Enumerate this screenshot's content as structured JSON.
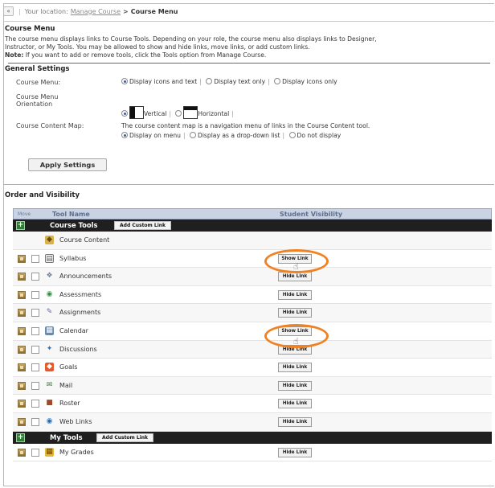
{
  "breadcrumb": {
    "back": "«",
    "prefix": "Your location:",
    "link": "Manage Course",
    "arrow": ">",
    "current": "Course Menu"
  },
  "course_menu": {
    "title": "Course Menu",
    "desc1": "The course menu displays links to Course Tools. Depending on your role, the course menu also displays links to Designer,",
    "desc2": "Instructor, or My Tools. You may be allowed to show and hide links, move links, or add custom links.",
    "note_label": "Note:",
    "note_text": " If you want to add or remove tools, click the Tools option from Manage Course."
  },
  "general": {
    "title": "General Settings",
    "menu_label": "Course Menu:",
    "menu_opts": [
      "Display icons and text",
      "Display text only",
      "Display icons only"
    ],
    "orient_label1": "Course Menu",
    "orient_label2": "Orientation",
    "orient_opts": [
      "Vertical",
      "Horizontal"
    ],
    "map_label": "Course Content Map:",
    "map_desc": "The course content map is a navigation menu of links in the Course Content tool.",
    "map_opts": [
      "Display on menu",
      "Display as a drop-down list",
      "Do not display"
    ],
    "apply": "Apply Settings"
  },
  "order": {
    "title": "Order and Visibility",
    "col_move": "Move",
    "col_name": "Tool Name",
    "col_vis": "Student Visibility",
    "groups": [
      {
        "name": "Course Tools",
        "add": "Add Custom Link",
        "tools": [
          {
            "name": "Course Content",
            "button": "",
            "icon": "content-icon"
          },
          {
            "name": "Syllabus",
            "button": "Show Link",
            "icon": "syllabus-icon"
          },
          {
            "name": "Announcements",
            "button": "Hide Link",
            "icon": "announcements-icon"
          },
          {
            "name": "Assessments",
            "button": "Hide Link",
            "icon": "assessments-icon"
          },
          {
            "name": "Assignments",
            "button": "Hide Link",
            "icon": "assignments-icon"
          },
          {
            "name": "Calendar",
            "button": "Show Link",
            "icon": "calendar-icon"
          },
          {
            "name": "Discussions",
            "button": "Hide Link",
            "icon": "discussions-icon"
          },
          {
            "name": "Goals",
            "button": "Hide Link",
            "icon": "goals-icon"
          },
          {
            "name": "Mail",
            "button": "Hide Link",
            "icon": "mail-icon"
          },
          {
            "name": "Roster",
            "button": "Hide Link",
            "icon": "roster-icon"
          },
          {
            "name": "Web Links",
            "button": "Hide Link",
            "icon": "web-links-icon"
          }
        ]
      },
      {
        "name": "My Tools",
        "add": "Add Custom Link",
        "tools": [
          {
            "name": "My Grades",
            "button": "Hide Link",
            "icon": "grades-icon"
          }
        ]
      }
    ],
    "plus": "+"
  },
  "colors": {
    "highlight_ring": "#f08222",
    "header_bg": "#c9d3e3",
    "group_bg": "#1f1f1f"
  }
}
